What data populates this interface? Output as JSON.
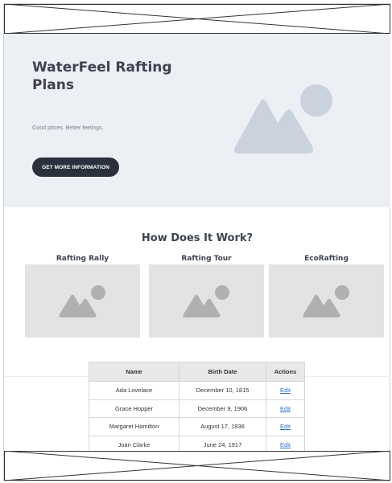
{
  "hero": {
    "title": "WaterFeel Rafting Plans",
    "subtitle": "Good prices. Better feelings.",
    "button_label": "GET MORE INFORMATION"
  },
  "section": {
    "title": "How Does It Work?",
    "cards": [
      {
        "label": "Rafting Rally"
      },
      {
        "label": "Rafting Tour"
      },
      {
        "label": "EcoRafting"
      }
    ]
  },
  "table": {
    "headers": [
      "Name",
      "Birth Date",
      "Actions"
    ],
    "rows": [
      {
        "name": "Ada Lovelace",
        "birth": "December 10, 1815",
        "action": "Edit"
      },
      {
        "name": "Grace Hopper",
        "birth": "December 9, 1906",
        "action": "Edit"
      },
      {
        "name": "Margaret Hamilton",
        "birth": "August 17, 1936",
        "action": "Edit"
      },
      {
        "name": "Joan Clarke",
        "birth": "June 24, 1917",
        "action": "Edit"
      }
    ]
  },
  "colors": {
    "hero_bg": "#eceff4",
    "button_bg": "#2b313c",
    "placeholder_gray": "#e3e3e3",
    "link": "#2a6fd6"
  }
}
